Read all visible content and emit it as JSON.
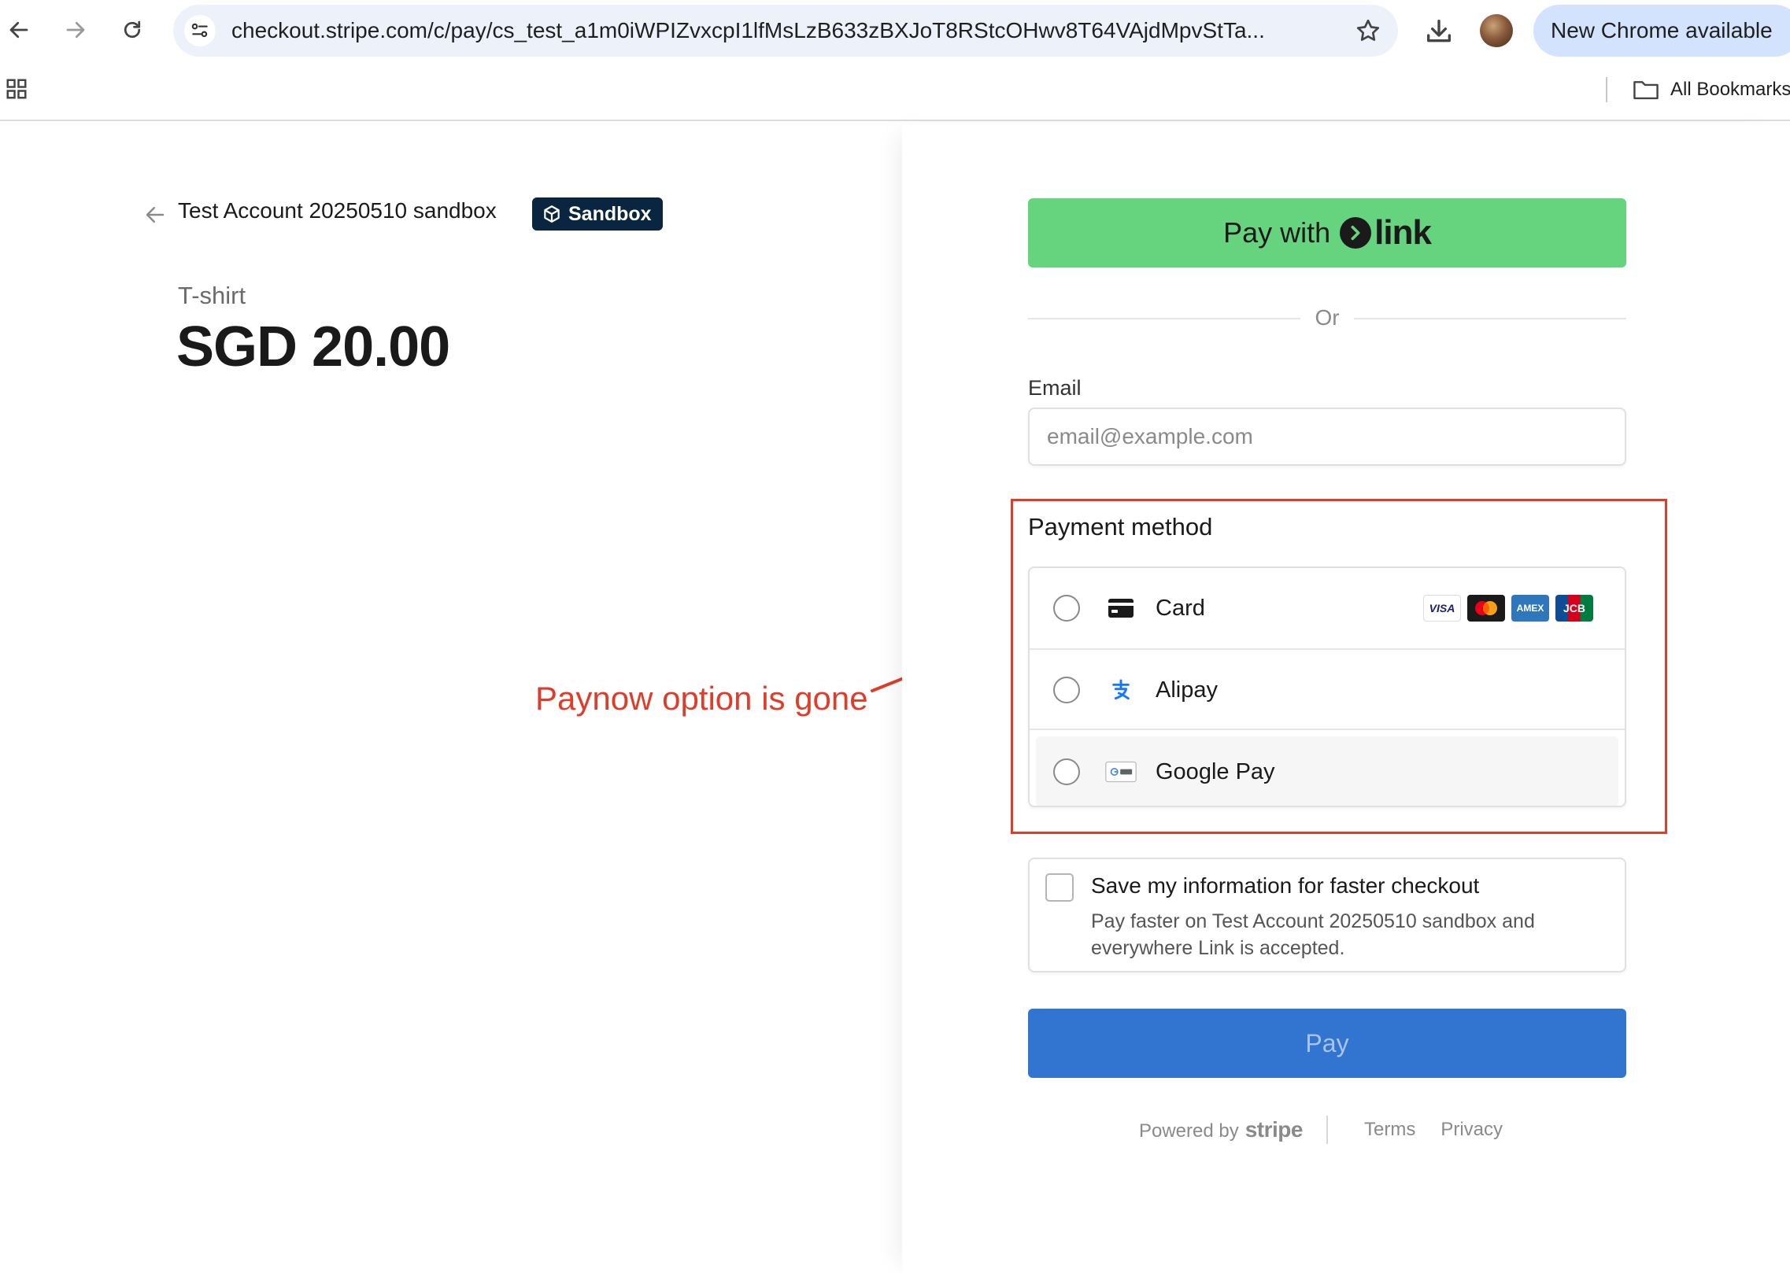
{
  "browser": {
    "url": "checkout.stripe.com/c/pay/cs_test_a1m0iWPIZvxcpI1lfMsLzB633zBXJoT8RStcOHwv8T64VAjdMpvStTa...",
    "update_chip": "New Chrome available",
    "bookmarks_label": "All Bookmarks"
  },
  "summary": {
    "merchant": "Test Account 20250510 sandbox",
    "badge": "Sandbox",
    "product": "T-shirt",
    "price": "SGD 20.00"
  },
  "annotation": {
    "text": "Paynow option is gone",
    "color": "#e03c2a"
  },
  "checkout": {
    "link_button_prefix": "Pay with",
    "link_logo_word": "link",
    "divider": "Or",
    "email_label": "Email",
    "email_placeholder": "email@example.com",
    "payment_title": "Payment method",
    "methods": [
      {
        "label": "Card",
        "icon": "card-icon"
      },
      {
        "label": "Alipay",
        "icon": "alipay-icon"
      },
      {
        "label": "Google Pay",
        "icon": "google-pay-icon"
      }
    ],
    "card_brands": [
      "VISA",
      "AMEX",
      "JCB"
    ],
    "save_title": "Save my information for faster checkout",
    "save_desc": "Pay faster on Test Account 20250510 sandbox and everywhere Link is accepted.",
    "pay_label": "Pay",
    "footer": {
      "powered_by": "Powered by",
      "brand": "stripe",
      "terms": "Terms",
      "privacy": "Privacy"
    }
  },
  "colors": {
    "link_green": "#66d47f",
    "pay_blue": "#3175d0",
    "sandbox_navy": "#0a2540"
  }
}
